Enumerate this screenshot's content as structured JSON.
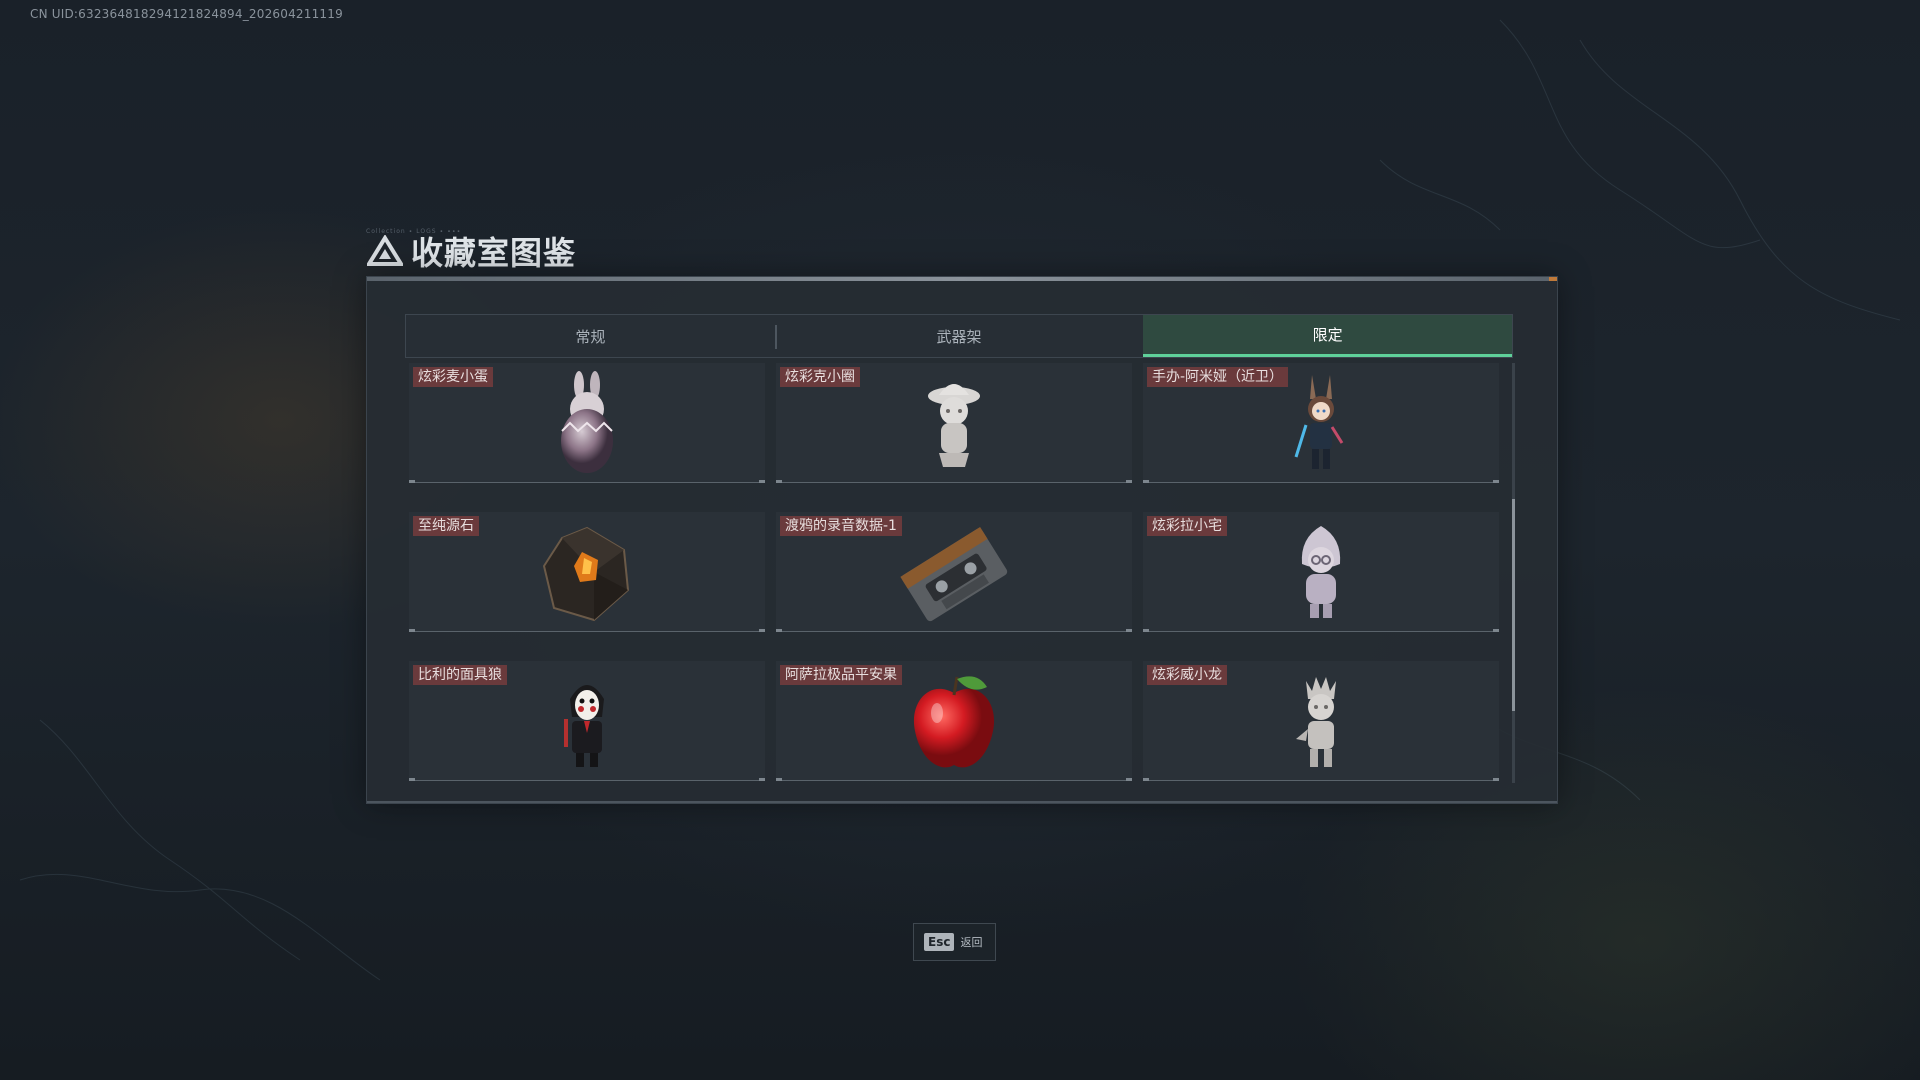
{
  "uid_text": "CN UID:632364818294121824894_202604211119",
  "title": "收藏室图鉴",
  "title_tiny": "Collection ∙ LOGS ∙ ∙∙∙",
  "tabs": [
    {
      "label": "常规",
      "active": false
    },
    {
      "label": "武器架",
      "active": false
    },
    {
      "label": "限定",
      "active": true
    }
  ],
  "items": [
    {
      "label": "炫彩麦小蛋",
      "icon": "rabbit-egg-figure-icon"
    },
    {
      "label": "炫彩克小圈",
      "icon": "hat-girl-figure-icon"
    },
    {
      "label": "手办-阿米娅（近卫）",
      "icon": "amiya-figure-icon"
    },
    {
      "label": "至纯源石",
      "icon": "originium-crystal-icon"
    },
    {
      "label": "渡鸦的录音数据-1",
      "icon": "cassette-tape-icon"
    },
    {
      "label": "炫彩拉小宅",
      "icon": "hooded-figure-icon"
    },
    {
      "label": "比利的面具狼",
      "icon": "billy-puppet-icon"
    },
    {
      "label": "阿萨拉极品平安果",
      "icon": "red-apple-icon"
    },
    {
      "label": "炫彩威小龙",
      "icon": "dragon-figure-icon"
    }
  ],
  "esc": {
    "key": "Esc",
    "label": "返回"
  },
  "colors": {
    "active_tab_bg": "#2f4a40",
    "active_tab_underline": "#5fd19a",
    "label_bg": "#6a3a3c",
    "accent_orange": "#c07a3a"
  }
}
